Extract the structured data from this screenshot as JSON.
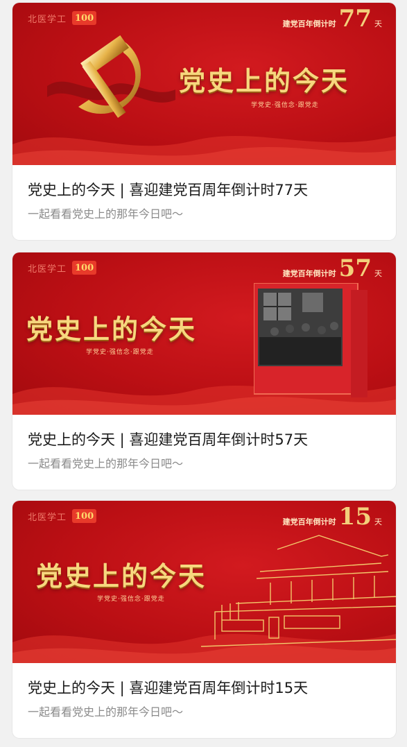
{
  "colors": {
    "banner_red": "#c0121a",
    "gold": "#f7d77e",
    "title_text": "#1b1b1b",
    "subtitle_text": "#8a8a8a"
  },
  "cards": [
    {
      "brand": "北医学工",
      "hundred": "100",
      "countdown_label": "建党百年倒计时",
      "countdown_number": "77",
      "countdown_unit": "天",
      "banner_title": "党史上的今天",
      "slogan": "学党史·强信念·跟党走",
      "title": "党史上的今天 | 喜迎建党百周年倒计时77天",
      "subtitle": "一起看看党史上的那年今日吧～",
      "image": "hammer-sickle-icon"
    },
    {
      "brand": "北医学工",
      "hundred": "100",
      "countdown_label": "建党百年倒计时",
      "countdown_number": "57",
      "countdown_unit": "天",
      "banner_title": "党史上的今天",
      "slogan": "学党史·强信念·跟党走",
      "title": "党史上的今天 | 喜迎建党百周年倒计时57天",
      "subtitle": "一起看看党史上的那年今日吧～",
      "image": "historical-photo"
    },
    {
      "brand": "北医学工",
      "hundred": "100",
      "countdown_label": "建党百年倒计时",
      "countdown_number": "15",
      "countdown_unit": "天",
      "banner_title": "党史上的今天",
      "slogan": "学党史·强信念·跟党走",
      "title": "党史上的今天 | 喜迎建党百周年倒计时15天",
      "subtitle": "一起看看党史上的那年今日吧～",
      "image": "tiananmen-line-art"
    }
  ]
}
